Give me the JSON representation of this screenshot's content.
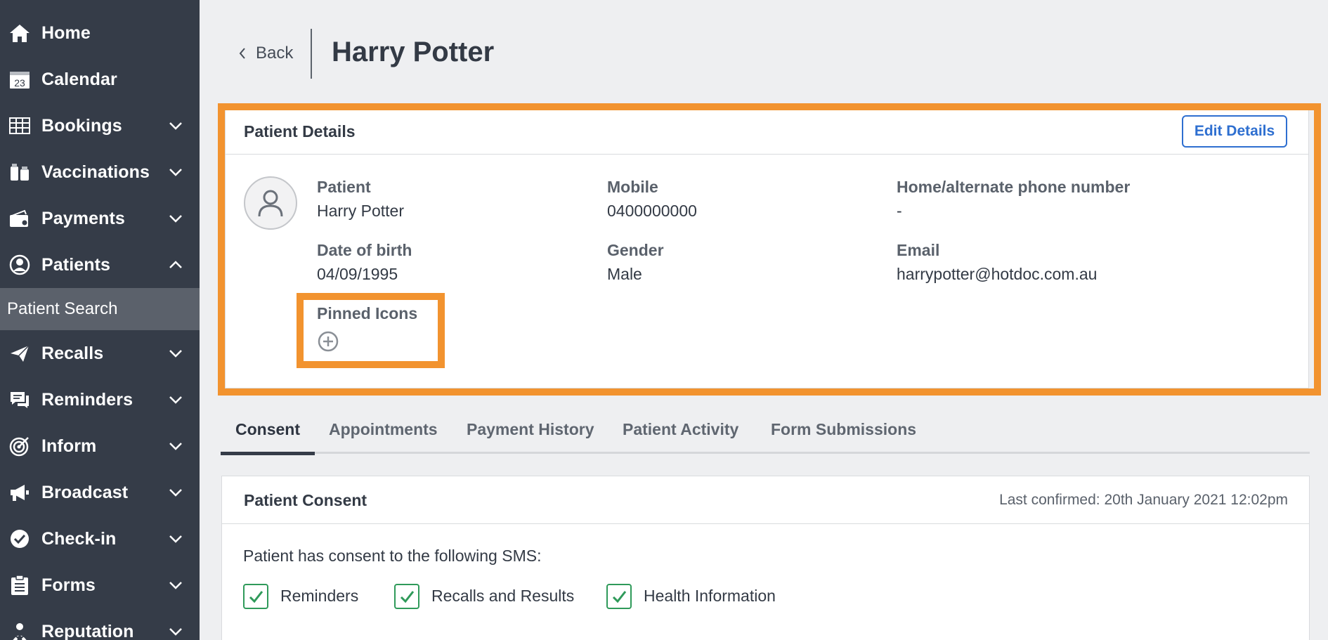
{
  "sidebar": {
    "items": [
      {
        "label": "Home",
        "icon": "home-icon"
      },
      {
        "label": "Calendar",
        "icon": "calendar-icon"
      },
      {
        "label": "Bookings",
        "icon": "bookings-icon"
      },
      {
        "label": "Vaccinations",
        "icon": "vaccinations-icon"
      },
      {
        "label": "Payments",
        "icon": "payments-icon"
      },
      {
        "label": "Patients",
        "icon": "patients-icon"
      },
      {
        "label": "Recalls",
        "icon": "recalls-icon"
      },
      {
        "label": "Reminders",
        "icon": "reminders-icon"
      },
      {
        "label": "Inform",
        "icon": "inform-icon"
      },
      {
        "label": "Broadcast",
        "icon": "broadcast-icon"
      },
      {
        "label": "Check-in",
        "icon": "check-in-icon"
      },
      {
        "label": "Forms",
        "icon": "forms-icon"
      },
      {
        "label": "Reputation",
        "icon": "reputation-icon"
      }
    ],
    "sub_item": "Patient Search",
    "calendar_day": "23"
  },
  "header": {
    "back_label": "Back",
    "title": "Harry Potter"
  },
  "patient_details": {
    "title": "Patient Details",
    "edit_label": "Edit Details",
    "fields": {
      "patient": {
        "label": "Patient",
        "value": "Harry Potter"
      },
      "mobile": {
        "label": "Mobile",
        "value": "0400000000"
      },
      "home_phone": {
        "label": "Home/alternate phone number",
        "value": "-"
      },
      "dob": {
        "label": "Date of birth",
        "value": "04/09/1995"
      },
      "gender": {
        "label": "Gender",
        "value": "Male"
      },
      "email": {
        "label": "Email",
        "value": "harrypotter@hotdoc.com.au"
      }
    },
    "pinned_icons_label": "Pinned Icons"
  },
  "tabs": [
    "Consent",
    "Appointments",
    "Payment History",
    "Patient Activity",
    "Form Submissions"
  ],
  "consent": {
    "title": "Patient Consent",
    "last_confirmed": "Last confirmed: 20th January 2021 12:02pm",
    "text": "Patient has consent to the following SMS:",
    "options": [
      "Reminders",
      "Recalls and Results",
      "Health Information"
    ]
  },
  "colors": {
    "sidebar_bg": "#353c48",
    "sidebar_active": "#5b616b",
    "highlight": "#f2932f",
    "link_blue": "#2e6fd0",
    "check_green": "#2f9a5a"
  }
}
